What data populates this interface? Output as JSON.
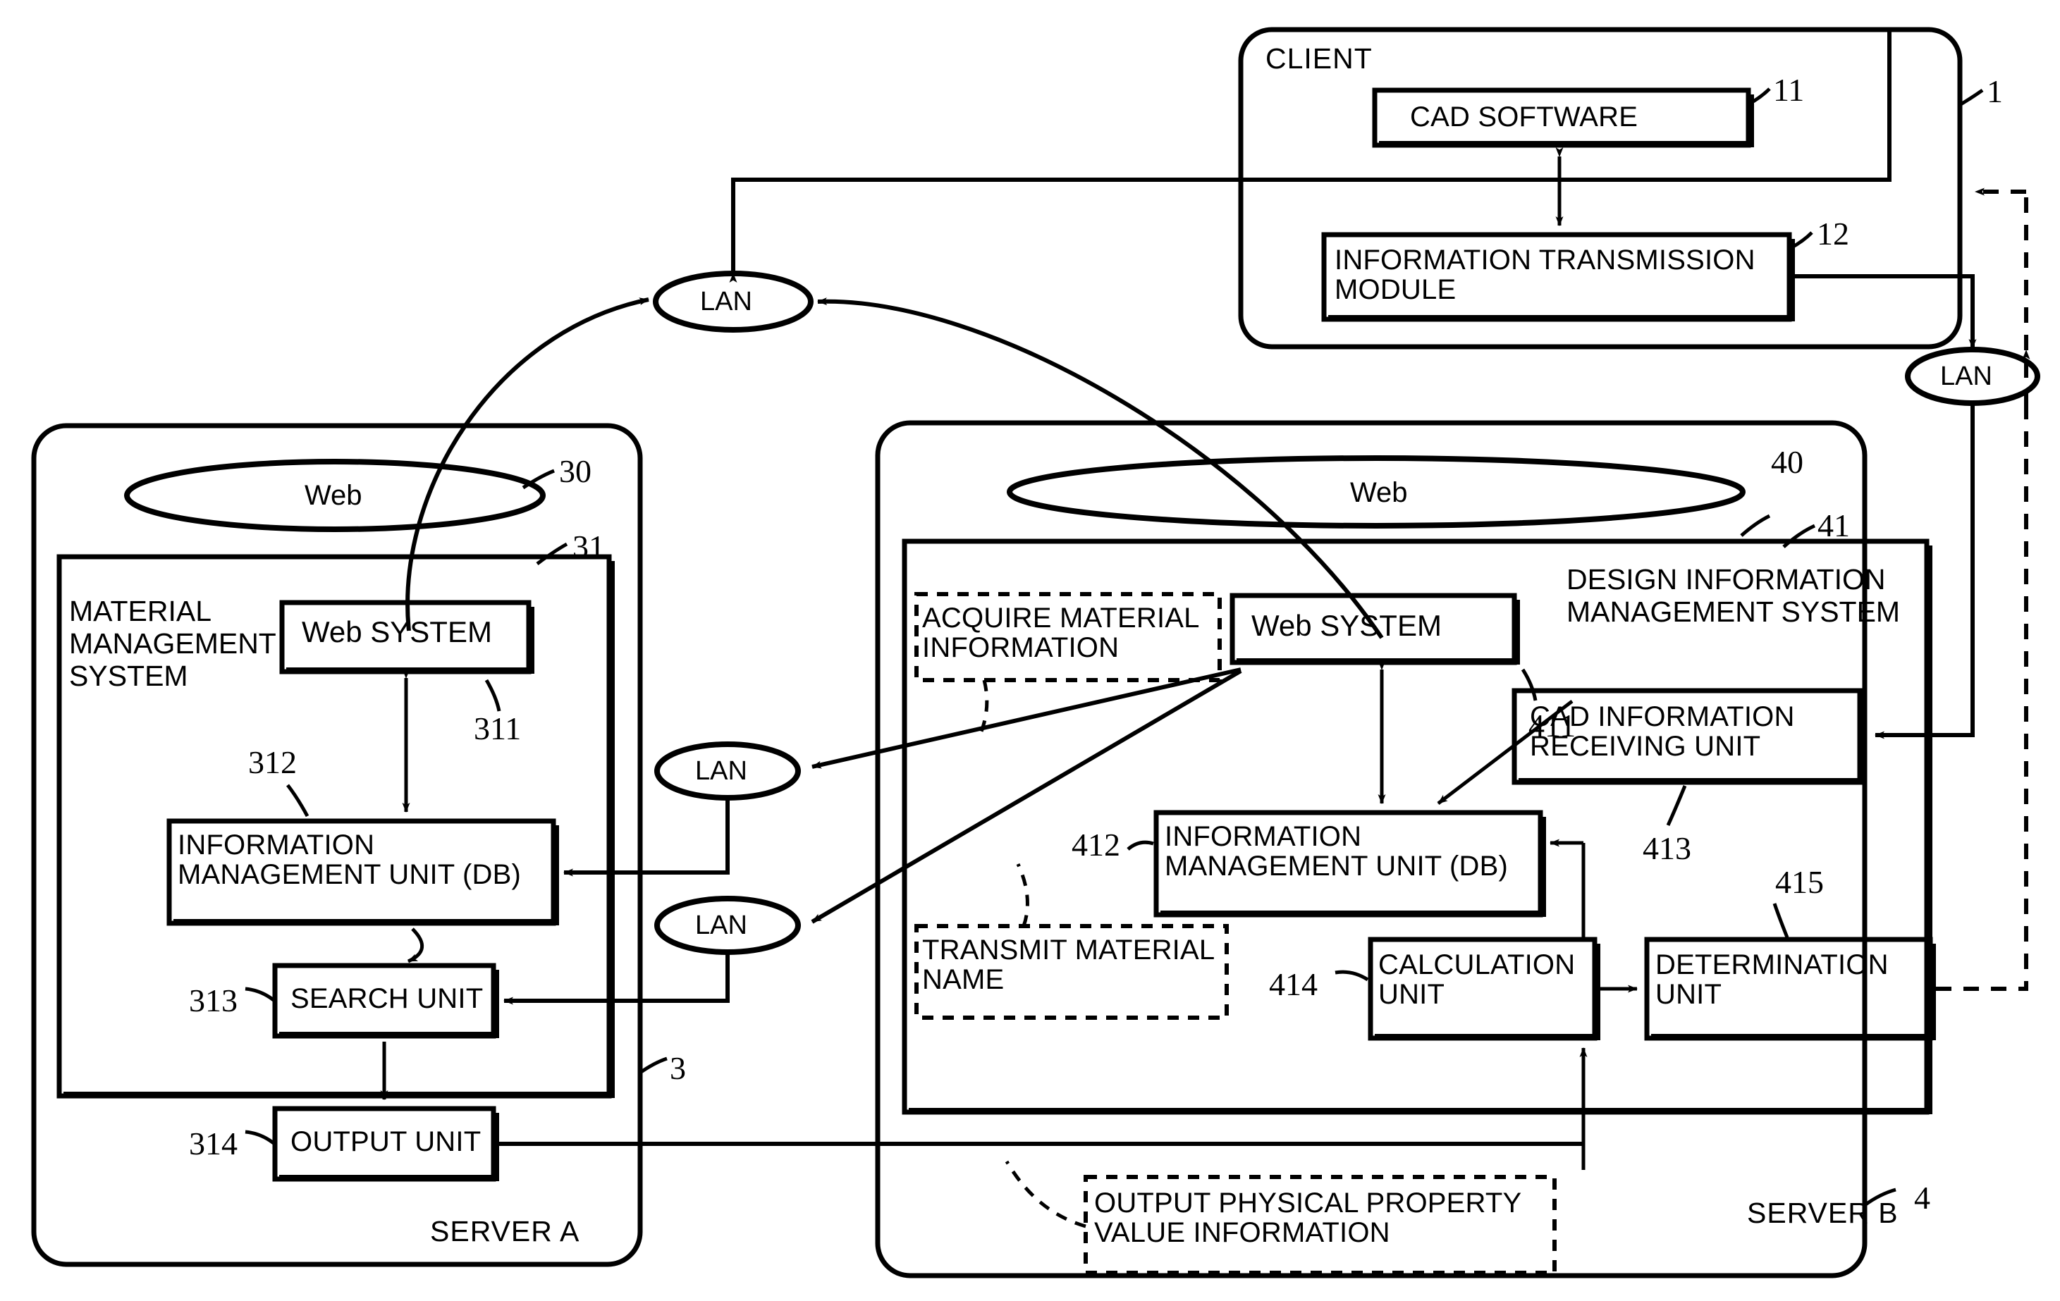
{
  "figure": {
    "type": "patent-block-diagram",
    "title": ""
  },
  "client": {
    "label": "CLIENT",
    "ref": "1",
    "blocks": [
      {
        "label": "CAD SOFTWARE",
        "ref": "11"
      },
      {
        "label": "INFORMATION TRANSMISSION\nMODULE",
        "ref": "12"
      }
    ]
  },
  "server_a": {
    "corner_label": "SERVER A",
    "ref": "3",
    "web_ellipse": {
      "label": "Web",
      "ref": "30"
    },
    "system": {
      "label": "MATERIAL\nMANAGEMENT\nSYSTEM",
      "ref": "31"
    },
    "blocks": [
      {
        "label": "Web SYSTEM",
        "ref": "311"
      },
      {
        "label": "INFORMATION\nMANAGEMENT UNIT (DB)",
        "ref": "312"
      },
      {
        "label": "SEARCH UNIT",
        "ref": "313"
      },
      {
        "label": "OUTPUT UNIT",
        "ref": "314"
      }
    ]
  },
  "server_b": {
    "corner_label": "SERVER B",
    "ref": "4",
    "web_ellipse": {
      "label": "Web",
      "ref": "40"
    },
    "system": {
      "label": "DESIGN INFORMATION\nMANAGEMENT SYSTEM",
      "ref": "41"
    },
    "blocks": [
      {
        "label": "Web SYSTEM",
        "ref": "411"
      },
      {
        "label": "INFORMATION\nMANAGEMENT UNIT (DB)",
        "ref": "412"
      },
      {
        "label": "CAD INFORMATION\nRECEIVING UNIT",
        "ref": "413"
      },
      {
        "label": "CALCULATION\nUNIT",
        "ref": "414"
      },
      {
        "label": "DETERMINATION\nUNIT",
        "ref": "415"
      }
    ],
    "annotations": [
      {
        "label": "ACQUIRE MATERIAL\nINFORMATION"
      },
      {
        "label": "TRANSMIT MATERIAL\nNAME"
      },
      {
        "label": "OUTPUT PHYSICAL PROPERTY\nVALUE INFORMATION"
      }
    ]
  },
  "network_nodes": [
    {
      "label": "LAN",
      "id": "lan-top"
    },
    {
      "label": "LAN",
      "id": "lan-right"
    },
    {
      "label": "LAN",
      "id": "lan-mid-upper"
    },
    {
      "label": "LAN",
      "id": "lan-mid-lower"
    }
  ],
  "colors": {
    "ink": "#000000",
    "paper": "#ffffff"
  }
}
